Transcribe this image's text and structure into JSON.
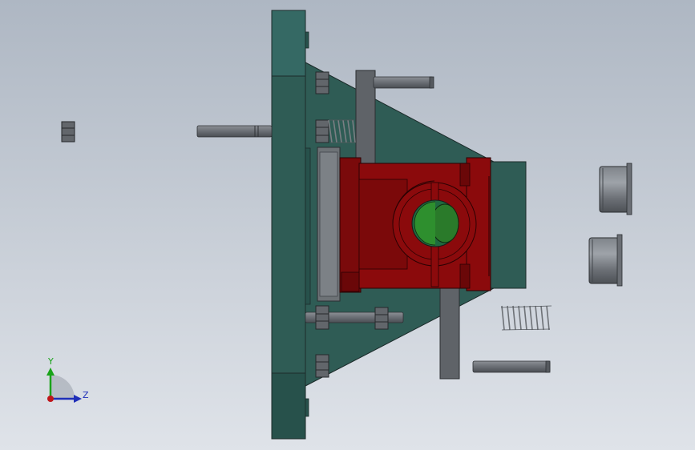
{
  "viewport": {
    "background_top": "#aeb7c3",
    "background_bottom": "#dfe3e9"
  },
  "colors": {
    "plate_green": "#2f5c55",
    "plate_green_light": "#356964",
    "plate_green_dark": "#27514b",
    "body_red": "#8b0a0c",
    "body_red_dark": "#6a0708",
    "steel_gray": "#6a6e74",
    "steel_dark": "#4e5257",
    "core_green": "#2a7a2a"
  },
  "triad": {
    "y_label": "Y",
    "z_label": "Z",
    "y_color": "#19a319",
    "z_color": "#1f2fb8",
    "origin_color": "#c0161a"
  }
}
